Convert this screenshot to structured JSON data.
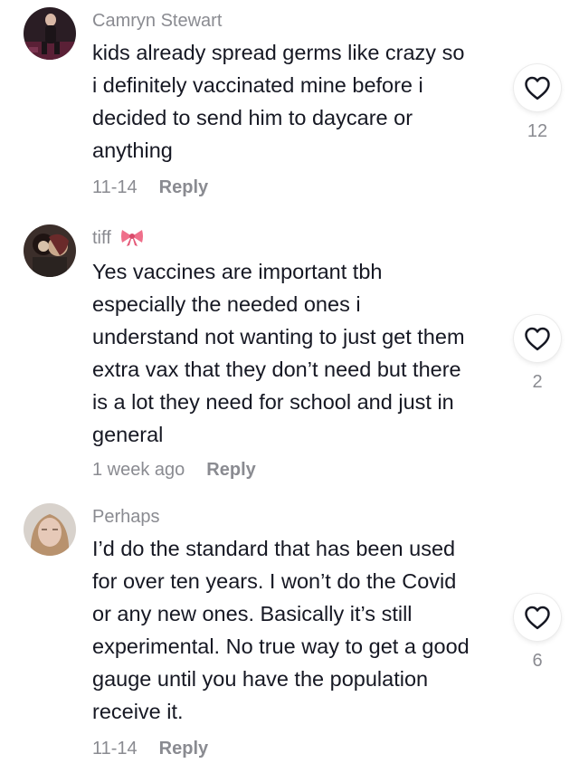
{
  "comments": [
    {
      "username": "Camryn Stewart",
      "lines": [
        "kids already spread germs like crazy so",
        "i definitely vaccinated mine before i",
        "decided to send him to daycare or",
        "anything"
      ],
      "time": "11-14",
      "reply_label": "Reply",
      "likes": "12",
      "avatar": "avatar-photo",
      "like_icon": "heart-outline-icon"
    },
    {
      "username": "tiff",
      "username_badge": "bow-emoji",
      "lines": [
        "Yes vaccines are important tbh",
        "especially the needed ones i",
        "understand not wanting to just get them",
        "extra vax that they don’t need but there",
        "is a lot they need for school and just in",
        "general"
      ],
      "time": "1 week ago",
      "reply_label": "Reply",
      "likes": "2",
      "avatar": "avatar-photo",
      "like_icon": "heart-outline-icon"
    },
    {
      "username": "Perhaps",
      "lines": [
        "I’d do the standard that has been used",
        "for over ten years. I won’t do the Covid",
        "or any new ones. Basically it’s still",
        "experimental. No true way to get a good",
        "gauge until you have the population",
        "receive it."
      ],
      "time": "11-14",
      "reply_label": "Reply",
      "likes": "6",
      "avatar": "avatar-photo",
      "like_icon": "heart-outline-icon"
    }
  ],
  "colors": {
    "text": "#161823",
    "secondary": "#8a8b91",
    "background": "#ffffff",
    "bow": "#ef6f8a"
  }
}
